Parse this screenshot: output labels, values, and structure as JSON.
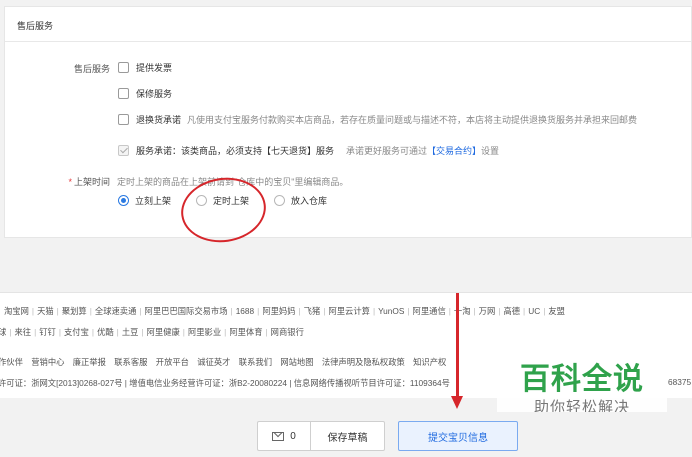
{
  "panel": {
    "title": "售后服务"
  },
  "after_sales": {
    "label": "售后服务",
    "options": [
      {
        "label": "提供发票",
        "checked": false
      },
      {
        "label": "保修服务",
        "checked": false
      },
      {
        "label": "退换货承诺",
        "checked": false,
        "desc": "凡使用支付宝服务付款购买本店商品，若存在质量问题或与描述不符，本店将主动提供退换货服务并承担来回邮费"
      }
    ],
    "commitment": {
      "label": "服务承诺：该类商品，必须支持【七天退货】服务",
      "checked": true,
      "note_prefix": "承诺更好服务可通过",
      "note_link": "【交易合约】",
      "note_suffix": "设置"
    }
  },
  "listing_time": {
    "required_mark": "*",
    "label": "上架时间",
    "hint": "定时上架的商品在上架前请到\"仓库中的宝贝\"里编辑商品。",
    "options": [
      {
        "label": "立刻上架",
        "selected": true
      },
      {
        "label": "定时上架",
        "selected": false
      },
      {
        "label": "放入仓库",
        "selected": false
      }
    ]
  },
  "footer": {
    "links_row1": [
      "淘宝网",
      "天猫",
      "聚划算",
      "全球速卖通",
      "阿里巴巴国际交易市场",
      "1688",
      "阿里妈妈",
      "飞猪",
      "阿里云计算",
      "YunOS",
      "阿里通信",
      "一淘",
      "万网",
      "高德",
      "UC",
      "友盟"
    ],
    "links_row2": [
      "球",
      "来往",
      "钉钉",
      "支付宝",
      "优酷",
      "土豆",
      "阿里健康",
      "阿里影业",
      "阿里体育",
      "网商银行"
    ],
    "links_row3": [
      "作伙伴",
      "营销中心",
      "廉正举报",
      "联系客服",
      "开放平台",
      "诚征英才",
      "联系我们",
      "网站地图",
      "法律声明及隐私权政策",
      "知识产权"
    ],
    "license_line": "许可证：浙网文[2013]0268-027号  |  增值电信业务经营许可证：浙B2-20080224  |  信息网络传播视听节目许可证：1109364号",
    "license_tail": "68375"
  },
  "watermark": {
    "main": "百科全说",
    "sub": "助你轻松解决"
  },
  "actions": {
    "message_count": "0",
    "save_draft": "保存草稿",
    "submit": "提交宝贝信息"
  }
}
